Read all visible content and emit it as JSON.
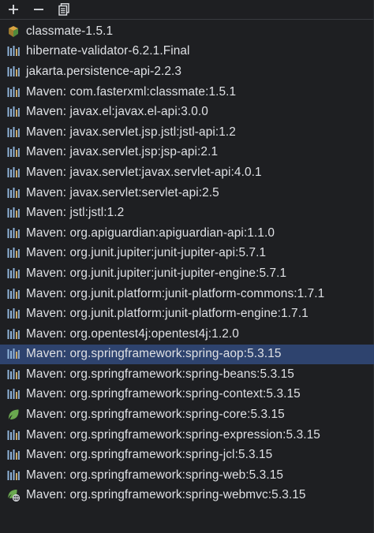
{
  "toolbar": {
    "add_icon": "plus-icon",
    "remove_icon": "minus-icon",
    "copy_icon": "copy-icon"
  },
  "colors": {
    "background": "#1e1f22",
    "selection": "#2e436e",
    "text": "#dfe1e5",
    "library_icon": "#8fb3d9",
    "spring_icon": "#6aa84f"
  },
  "libraries": [
    {
      "label": "classmate-1.5.1",
      "icon": "jar-icon",
      "selected": false
    },
    {
      "label": "hibernate-validator-6.2.1.Final",
      "icon": "library-icon",
      "selected": false
    },
    {
      "label": "jakarta.persistence-api-2.2.3",
      "icon": "library-icon",
      "selected": false
    },
    {
      "label": "Maven: com.fasterxml:classmate:1.5.1",
      "icon": "library-icon",
      "selected": false
    },
    {
      "label": "Maven: javax.el:javax.el-api:3.0.0",
      "icon": "library-icon",
      "selected": false
    },
    {
      "label": "Maven: javax.servlet.jsp.jstl:jstl-api:1.2",
      "icon": "library-icon",
      "selected": false
    },
    {
      "label": "Maven: javax.servlet.jsp:jsp-api:2.1",
      "icon": "library-icon",
      "selected": false
    },
    {
      "label": "Maven: javax.servlet:javax.servlet-api:4.0.1",
      "icon": "library-icon",
      "selected": false
    },
    {
      "label": "Maven: javax.servlet:servlet-api:2.5",
      "icon": "library-icon",
      "selected": false
    },
    {
      "label": "Maven: jstl:jstl:1.2",
      "icon": "library-icon",
      "selected": false
    },
    {
      "label": "Maven: org.apiguardian:apiguardian-api:1.1.0",
      "icon": "library-icon",
      "selected": false
    },
    {
      "label": "Maven: org.junit.jupiter:junit-jupiter-api:5.7.1",
      "icon": "library-icon",
      "selected": false
    },
    {
      "label": "Maven: org.junit.jupiter:junit-jupiter-engine:5.7.1",
      "icon": "library-icon",
      "selected": false
    },
    {
      "label": "Maven: org.junit.platform:junit-platform-commons:1.7.1",
      "icon": "library-icon",
      "selected": false
    },
    {
      "label": "Maven: org.junit.platform:junit-platform-engine:1.7.1",
      "icon": "library-icon",
      "selected": false
    },
    {
      "label": "Maven: org.opentest4j:opentest4j:1.2.0",
      "icon": "library-icon",
      "selected": false
    },
    {
      "label": "Maven: org.springframework:spring-aop:5.3.15",
      "icon": "library-icon",
      "selected": true
    },
    {
      "label": "Maven: org.springframework:spring-beans:5.3.15",
      "icon": "library-icon",
      "selected": false
    },
    {
      "label": "Maven: org.springframework:spring-context:5.3.15",
      "icon": "library-icon",
      "selected": false
    },
    {
      "label": "Maven: org.springframework:spring-core:5.3.15",
      "icon": "spring-leaf-icon",
      "selected": false
    },
    {
      "label": "Maven: org.springframework:spring-expression:5.3.15",
      "icon": "library-icon",
      "selected": false
    },
    {
      "label": "Maven: org.springframework:spring-jcl:5.3.15",
      "icon": "library-icon",
      "selected": false
    },
    {
      "label": "Maven: org.springframework:spring-web:5.3.15",
      "icon": "library-icon",
      "selected": false
    },
    {
      "label": "Maven: org.springframework:spring-webmvc:5.3.15",
      "icon": "spring-web-icon",
      "selected": false
    }
  ]
}
